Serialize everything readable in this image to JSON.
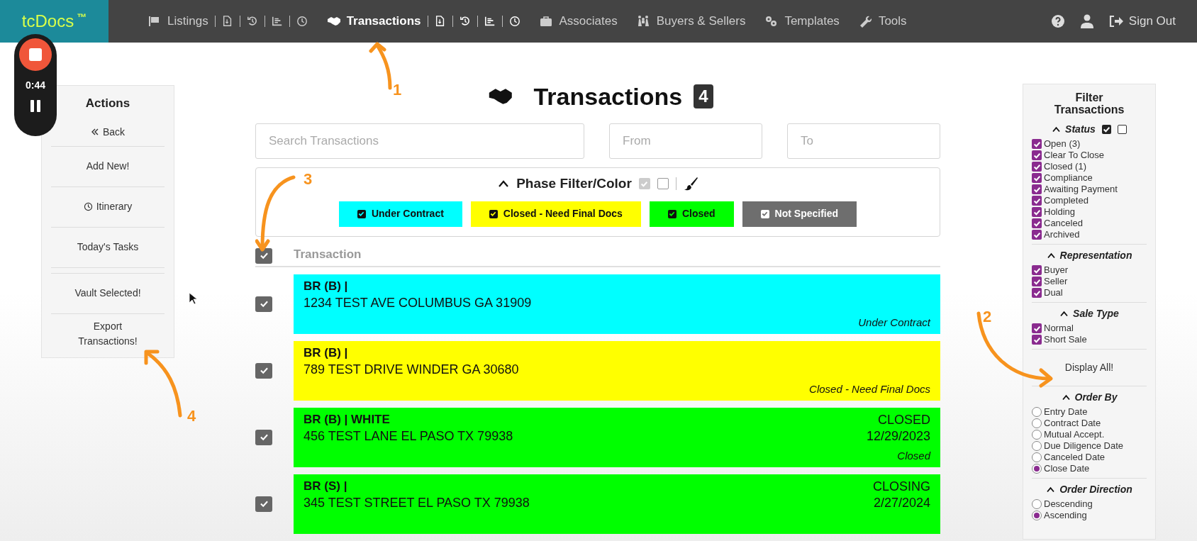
{
  "nav": {
    "logo": "tcDocs",
    "logo_mark": "™",
    "items": [
      {
        "label": "Listings",
        "kind": "quick",
        "selected": false
      },
      {
        "label": "Transactions",
        "kind": "quick",
        "selected": true
      },
      {
        "label": "Associates",
        "kind": "plain",
        "selected": false
      },
      {
        "label": "Buyers & Sellers",
        "kind": "plain",
        "selected": false
      },
      {
        "label": "Templates",
        "kind": "plain",
        "selected": false
      },
      {
        "label": "Tools",
        "kind": "plain",
        "selected": false
      }
    ],
    "sign_out": "Sign Out"
  },
  "recorder": {
    "time": "0:44"
  },
  "actions": {
    "title": "Actions",
    "groups": [
      {
        "items": [
          {
            "label": "Back",
            "kind": "back"
          },
          {
            "label": "Add New!",
            "kind": "plain"
          },
          {
            "label": "Itinerary",
            "kind": "clock"
          },
          {
            "label": "Today's Tasks",
            "kind": "plain"
          }
        ]
      },
      {
        "items": [
          {
            "label": "Vault Selected!",
            "kind": "plain"
          },
          {
            "label": "Export Transactions!",
            "kind": "plain"
          }
        ]
      }
    ]
  },
  "page": {
    "title": "Transactions",
    "count": "4"
  },
  "search": {
    "placeholder": "Search Transactions"
  },
  "from": {
    "placeholder": "From"
  },
  "to": {
    "placeholder": "To"
  },
  "phase_filter": {
    "title": "Phase Filter/Color",
    "all_toggle": {
      "checked": true
    },
    "none_toggle": {
      "checked": false
    },
    "phases": [
      {
        "label": "Under Contract",
        "color": "#00ffff",
        "checked": true
      },
      {
        "label": "Closed - Need Final Docs",
        "color": "#ffff00",
        "checked": true
      },
      {
        "label": "Closed",
        "color": "#00ff00",
        "checked": true
      },
      {
        "label": "Not Specified",
        "color": "#6e6e6e",
        "checked": true
      }
    ]
  },
  "table": {
    "select_all": {
      "checked": true
    },
    "column": "Transaction",
    "rows": [
      {
        "title": "BR (B) |",
        "address": "1234 TEST AVE COLUMBUS GA 31909",
        "status": [],
        "phase": "Under Contract",
        "color": "#00ffff",
        "checked": true
      },
      {
        "title": "BR (B) |",
        "address": "789 TEST DRIVE WINDER GA 30680",
        "status": [],
        "phase": "Closed - Need Final Docs",
        "color": "#ffff00",
        "checked": true
      },
      {
        "title": "BR (B) | WHITE",
        "address": "456 TEST LANE EL PASO TX 79938",
        "status": [
          "CLOSED",
          "12/29/2023"
        ],
        "phase": "Closed",
        "color": "#00ff00",
        "checked": true
      },
      {
        "title": "BR (S) |",
        "address": "345 TEST STREET EL PASO TX 79938",
        "status": [
          "CLOSING",
          "2/27/2024"
        ],
        "color": "#00ff00",
        "checked": true
      }
    ]
  },
  "filter": {
    "title": "Filter Transactions",
    "sections": [
      {
        "title": "Status",
        "toggles": [
          {
            "checked": true
          },
          {
            "checked": false
          }
        ],
        "items": [
          {
            "label": "Open (3)",
            "kind": "checkbox",
            "checked": true
          },
          {
            "label": "Clear To Close",
            "kind": "checkbox",
            "checked": true
          },
          {
            "label": "Closed (1)",
            "kind": "checkbox",
            "checked": true
          },
          {
            "label": "Compliance",
            "kind": "checkbox",
            "checked": true
          },
          {
            "label": "Awaiting Payment",
            "kind": "checkbox",
            "checked": true
          },
          {
            "label": "Completed",
            "kind": "checkbox",
            "checked": true
          },
          {
            "label": "Holding",
            "kind": "checkbox",
            "checked": true
          },
          {
            "label": "Canceled",
            "kind": "checkbox",
            "checked": true
          },
          {
            "label": "Archived",
            "kind": "checkbox",
            "checked": true
          }
        ]
      },
      {
        "title": "Representation",
        "items": [
          {
            "label": "Buyer",
            "kind": "checkbox",
            "checked": true
          },
          {
            "label": "Seller",
            "kind": "checkbox",
            "checked": true
          },
          {
            "label": "Dual",
            "kind": "checkbox",
            "checked": true
          }
        ]
      },
      {
        "title": "Sale Type",
        "items": [
          {
            "label": "Normal",
            "kind": "checkbox",
            "checked": true
          },
          {
            "label": "Short Sale",
            "kind": "checkbox",
            "checked": true
          }
        ]
      },
      {
        "button": "Display All!"
      },
      {
        "title": "Order By",
        "items": [
          {
            "label": "Entry Date",
            "kind": "radio",
            "selected": false
          },
          {
            "label": "Contract Date",
            "kind": "radio",
            "selected": false
          },
          {
            "label": "Mutual Accept.",
            "kind": "radio",
            "selected": false
          },
          {
            "label": "Due Diligence Date",
            "kind": "radio",
            "selected": false
          },
          {
            "label": "Canceled Date",
            "kind": "radio",
            "selected": false
          },
          {
            "label": "Close Date",
            "kind": "radio",
            "selected": true
          }
        ]
      },
      {
        "title": "Order Direction",
        "items": [
          {
            "label": "Descending",
            "kind": "radio",
            "selected": false
          },
          {
            "label": "Ascending",
            "kind": "radio",
            "selected": true
          }
        ]
      }
    ]
  },
  "annotations": [
    {
      "label": "1"
    },
    {
      "label": "2"
    },
    {
      "label": "3"
    },
    {
      "label": "4"
    }
  ]
}
